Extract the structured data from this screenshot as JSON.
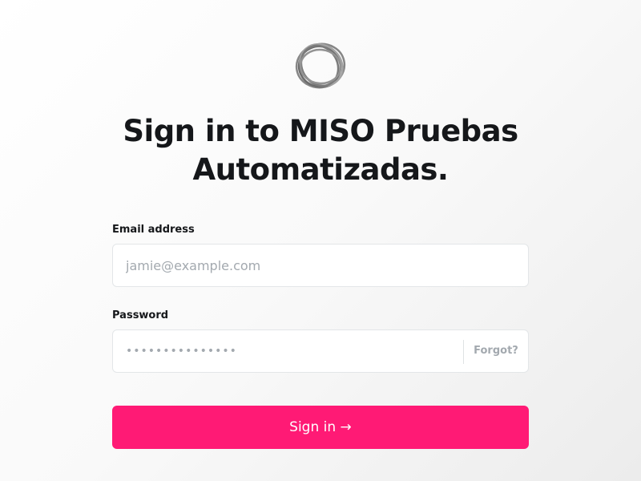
{
  "logo": {
    "icon": "circle-scribble-logo"
  },
  "heading": "Sign in to MISO Pruebas Automatizadas.",
  "email": {
    "label": "Email address",
    "placeholder": "jamie@example.com",
    "value": ""
  },
  "password": {
    "label": "Password",
    "value": "•••••••••••••••",
    "forgot_label": "Forgot?"
  },
  "submit": {
    "label": "Sign in →"
  },
  "colors": {
    "accent": "#ff1a75",
    "text": "#15171a",
    "muted": "#a3a9af"
  }
}
